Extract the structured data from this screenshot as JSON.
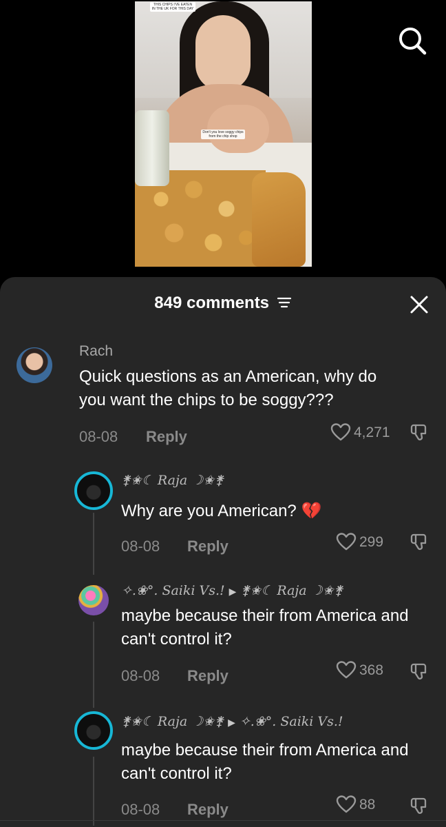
{
  "video": {
    "top_caption": "THIS CHIPS I'VE EATEN IN THE UK FOR THIS DAY",
    "mid_caption": "Don't you love soggy chips from the chip shop"
  },
  "header": {
    "comment_count": "849 comments"
  },
  "comments": [
    {
      "username": "Rach",
      "text": "Quick questions as an American, why do you want the chips to be soggy???",
      "date": "08-08",
      "reply_label": "Reply",
      "likes": "4,271"
    },
    {
      "username": "⚵✬☾ Raja ☽✬⚵",
      "text": "Why are you American? 💔",
      "date": "08-08",
      "reply_label": "Reply",
      "likes": "299"
    },
    {
      "username": "✧.❀°. Saiki Vs.!",
      "reply_to": "⚵✬☾ Raja ☽✬⚵",
      "text": "maybe because their from America and can't control it?",
      "date": "08-08",
      "reply_label": "Reply",
      "likes": "368"
    },
    {
      "username": "⚵✬☾ Raja ☽✬⚵",
      "reply_to": "✧.❀°. Saiki Vs.!",
      "text": "maybe because their from America and can't control it?",
      "date": "08-08",
      "reply_label": "Reply",
      "likes": "88"
    }
  ],
  "icons": {
    "search": "search-icon",
    "filter": "filter-icon",
    "close": "close-icon",
    "like": "heart-icon",
    "dislike": "dislike-icon"
  },
  "colors": {
    "sheet_bg": "#262626",
    "accent_ring": "#17b7d6",
    "muted_text": "#8a8a8a"
  }
}
